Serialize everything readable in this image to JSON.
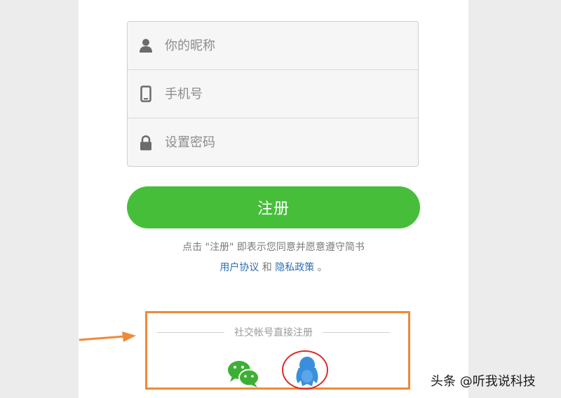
{
  "form": {
    "nickname": {
      "placeholder": "你的昵称",
      "icon": "user-icon"
    },
    "phone": {
      "placeholder": "手机号",
      "icon": "phone-icon"
    },
    "password": {
      "placeholder": "设置密码",
      "icon": "lock-icon"
    }
  },
  "register_button": {
    "label": "注册",
    "color": "#46be3a"
  },
  "agreement": {
    "text": "点击 \"注册\" 即表示您同意并愿意遵守简书",
    "user_agreement": "用户协议",
    "and": "和",
    "privacy_policy": "隐私政策",
    "period": "。"
  },
  "social": {
    "title": "社交帐号直接注册",
    "providers": [
      {
        "name": "wechat",
        "icon": "wechat-icon",
        "color": "#3cb034"
      },
      {
        "name": "qq",
        "icon": "qq-icon",
        "color": "#3a8fdc"
      }
    ],
    "highlight_color": "#ee8a3a",
    "circle_color": "#d82c2c"
  },
  "watermark": "头条 @听我说科技"
}
